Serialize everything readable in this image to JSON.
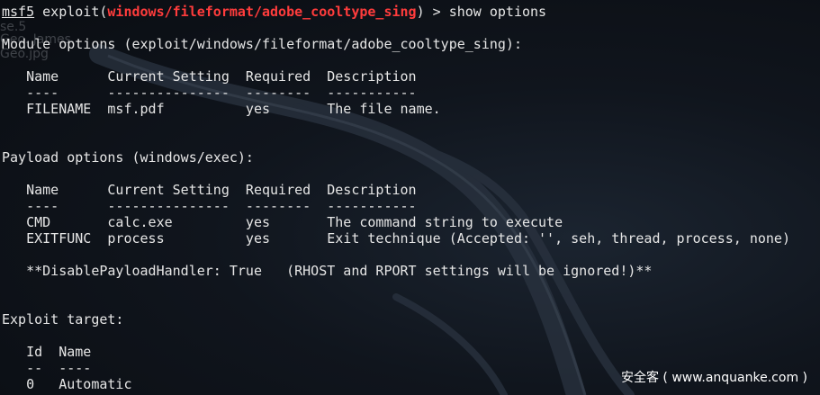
{
  "background_ghosts": {
    "top1": "se.5",
    "name": "Geo. James",
    "file": "Geo.jpg"
  },
  "prompt": {
    "console": "msf5",
    "cmd_prefix": " exploit(",
    "module": "windows/fileformat/adobe_cooltype_sing",
    "cmd_suffix": ") > show options"
  },
  "module_options": {
    "heading": "Module options (exploit/windows/fileformat/adobe_cooltype_sing):",
    "header_row": "   Name      Current Setting  Required  Description",
    "separator_row": "   ----      ---------------  --------  -----------",
    "rows": [
      "   FILENAME  msf.pdf          yes       The file name."
    ]
  },
  "payload_options": {
    "heading": "Payload options (windows/exec):",
    "header_row": "   Name      Current Setting  Required  Description",
    "separator_row": "   ----      ---------------  --------  -----------",
    "rows": [
      "   CMD       calc.exe         yes       The command string to execute",
      "   EXITFUNC  process          yes       Exit technique (Accepted: '', seh, thread, process, none)"
    ],
    "note": "   **DisablePayloadHandler: True   (RHOST and RPORT settings will be ignored!)**"
  },
  "exploit_target": {
    "heading": "Exploit target:",
    "header_row": "   Id  Name",
    "separator_row": "   --  ----",
    "rows": [
      "   0   Automatic"
    ]
  },
  "watermark": "安全客 ( www.anquanke.com )",
  "colors": {
    "text": "#e6e6e6",
    "module_highlight": "#ff3c3c",
    "background": "#0d1017"
  }
}
